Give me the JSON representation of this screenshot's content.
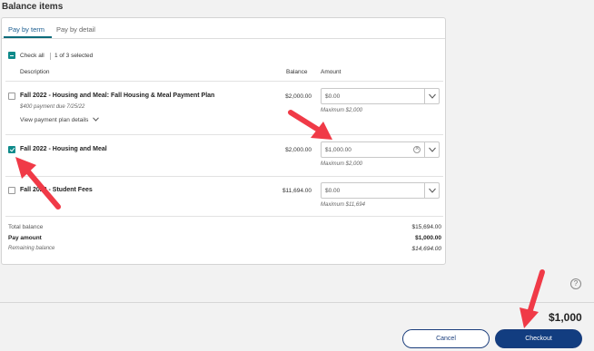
{
  "page_title": "Balance items",
  "tabs": [
    {
      "label": "Pay by term",
      "active": true
    },
    {
      "label": "Pay by detail",
      "active": false
    }
  ],
  "check_all": {
    "label": "Check all",
    "selection_text": "1 of 3 selected"
  },
  "columns": {
    "description": "Description",
    "balance": "Balance",
    "amount": "Amount"
  },
  "items": [
    {
      "checked": false,
      "title": "Fall 2022 - Housing and Meal: Fall Housing & Meal Payment Plan",
      "subtitle": "$400 payment due 7/25/22",
      "link": "View payment plan details",
      "balance": "$2,000.00",
      "amount": "$0.00",
      "maximum": "Maximum $2,000"
    },
    {
      "checked": true,
      "title": "Fall 2022 - Housing and Meal",
      "balance": "$2,000.00",
      "amount": "$1,000.00",
      "maximum": "Maximum $2,000"
    },
    {
      "checked": false,
      "title": "Fall 2022 - Student Fees",
      "balance": "$11,694.00",
      "amount": "$0.00",
      "maximum": "Maximum $11,694"
    }
  ],
  "summary": {
    "total_balance_label": "Total balance",
    "total_balance": "$15,694.00",
    "pay_amount_label": "Pay amount",
    "pay_amount": "$1,000.00",
    "remaining_label": "Remaining balance",
    "remaining": "$14,694.00"
  },
  "footer": {
    "total": "$1,000",
    "cancel_label": "Cancel",
    "checkout_label": "Checkout",
    "help_icon": "?"
  },
  "colors": {
    "accent": "#0e8a8a",
    "primary_button": "#123d80",
    "annotation_arrow": "#f03a47"
  }
}
